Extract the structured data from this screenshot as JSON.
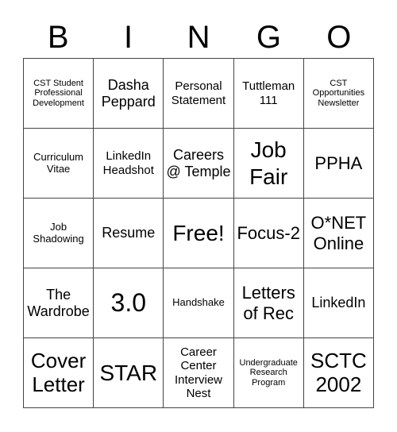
{
  "header": {
    "letters": [
      "B",
      "I",
      "N",
      "G",
      "O"
    ]
  },
  "board": {
    "rows": [
      [
        "CST Student Professional Development",
        "Dasha Peppard",
        "Personal Statement",
        "Tuttleman 111",
        "CST Opportunities Newsletter"
      ],
      [
        "Curriculum Vitae",
        "LinkedIn Headshot",
        "Careers @ Temple",
        "Job Fair",
        "PPHA"
      ],
      [
        "Job Shadowing",
        "Resume",
        "Free!",
        "Focus-2",
        "O*NET Online"
      ],
      [
        "The Wardrobe",
        "3.0",
        "Handshake",
        "Letters of Rec",
        "LinkedIn"
      ],
      [
        "Cover Letter",
        "STAR",
        "Career Center Interview Nest",
        "Undergraduate Research Program",
        "SCTC 2002"
      ]
    ]
  },
  "colors": {
    "border": "#444444",
    "background": "#ffffff",
    "text": "#000000"
  }
}
